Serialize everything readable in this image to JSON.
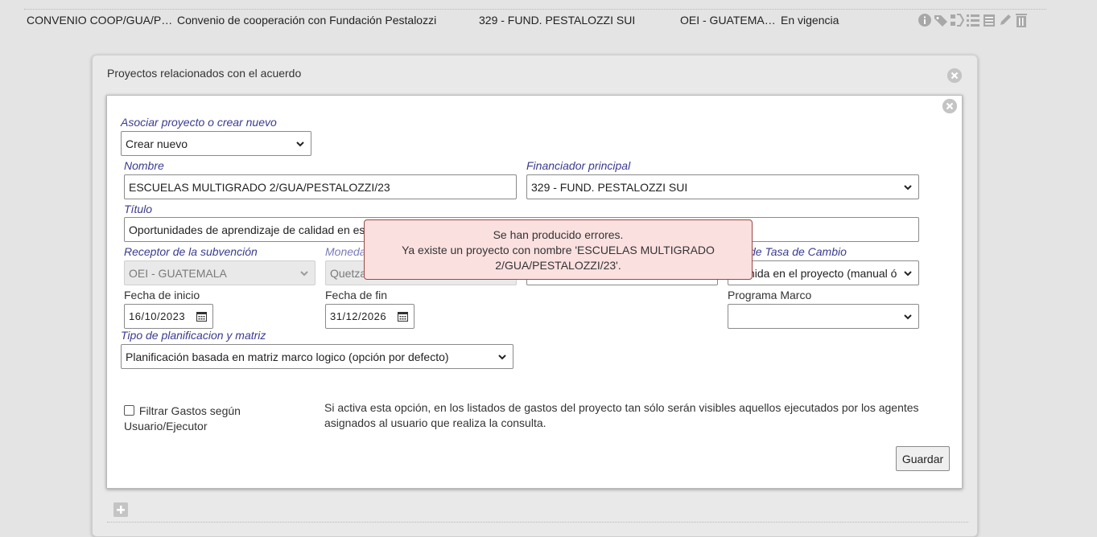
{
  "background_row": {
    "code": "CONVENIO COOP/GUA/P…",
    "description": "Convenio de cooperación con Fundación Pestalozzi",
    "financier": "329 - FUND. PESTALOZZI SUI",
    "receiver": "OEI - GUATEMA…",
    "status": "En vigencia",
    "icons": [
      "info-icon",
      "tag-icon",
      "split-icon",
      "list-icon",
      "stack-icon",
      "pencil-icon",
      "trash-icon"
    ]
  },
  "outer_modal": {
    "title": "Proyectos relacionados con el acuerdo"
  },
  "form": {
    "associate_label": "Asociar proyecto o crear nuevo",
    "associate_value": "Crear nuevo",
    "nombre_label": "Nombre",
    "nombre_value": "ESCUELAS MULTIGRADO 2/GUA/PESTALOZZI/23",
    "financiador_label": "Financiador principal",
    "financiador_value": "329 - FUND. PESTALOZZI SUI",
    "titulo_label": "Título",
    "titulo_value": "Oportunidades de aprendizaje de calidad en esc",
    "receptor_label": "Receptor de la subvención",
    "receptor_value": "OEI - GUATEMALA",
    "moneda_label": "Moneda",
    "moneda_value": "Quetza",
    "tasa_label": "de Tasa de Cambio",
    "tasa_value": "nida en el proyecto (manual ó",
    "fecha_inicio_label": "Fecha de inicio",
    "fecha_inicio_value": "16/10/2023",
    "fecha_fin_label": "Fecha de fin",
    "fecha_fin_value": "31/12/2026",
    "programa_label": "Programa Marco",
    "programa_value": "",
    "tipo_label": "Tipo de planificacion y matriz",
    "tipo_value": "Planificación basada en matriz marco logico (opción por defecto)",
    "filtrar_label": "Filtrar Gastos según Usuario/Ejecutor",
    "filtrar_checked": false,
    "filtrar_help": "Si activa esta opción, en los listados de gastos del proyecto tan sólo serán visibles aquellos ejecutados por los agentes asignados al usuario que realiza la consulta.",
    "save_label": "Guardar"
  },
  "error": {
    "title": "Se han producido errores.",
    "message": "Ya existe un proyecto con nombre 'ESCUELAS MULTIGRADO 2/GUA/PESTALOZZI/23'."
  },
  "colors": {
    "label_blue": "#3b3b8f",
    "error_bg": "#fbe0e0",
    "error_border": "#9a4848"
  }
}
